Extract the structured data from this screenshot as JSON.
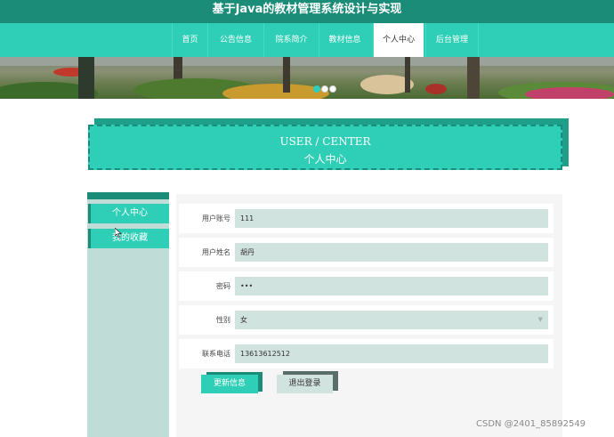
{
  "site": {
    "title": "基于Java的教材管理系统设计与实现"
  },
  "nav": {
    "items": [
      {
        "label": "首页"
      },
      {
        "label": "公告信息"
      },
      {
        "label": "院系简介"
      },
      {
        "label": "教材信息"
      },
      {
        "label": "个人中心"
      },
      {
        "label": "后台管理"
      }
    ],
    "active_label": "个人中心"
  },
  "banner": {
    "slide_count": 3,
    "active_slide": 1
  },
  "center": {
    "title_en": "USER / CENTER",
    "title_cn": "个人中心"
  },
  "sidebar": {
    "items": [
      {
        "label": "个人中心"
      },
      {
        "label": "我的收藏"
      }
    ]
  },
  "form": {
    "fields": [
      {
        "label": "用户账号",
        "value": "111"
      },
      {
        "label": "用户姓名",
        "value": "胡丹"
      },
      {
        "label": "密码",
        "value": "•••"
      },
      {
        "label": "性别",
        "value": "女"
      },
      {
        "label": "联系电话",
        "value": "13613612512"
      }
    ],
    "update_label": "更新信息",
    "logout_label": "退出登录"
  },
  "watermark": "CSDN @2401_85892549",
  "colors": {
    "primary": "#2ecfb6",
    "dark": "#1a8c78",
    "field_bg": "#d1e3df",
    "sidebar_bg": "#bfdcd7"
  }
}
